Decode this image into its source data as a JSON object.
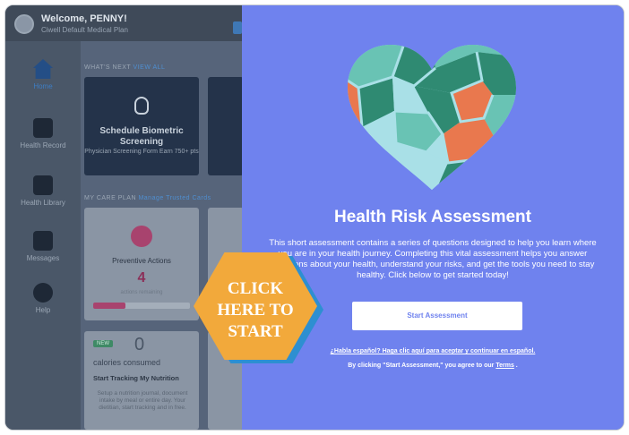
{
  "app": {
    "welcome": "Welcome, PENNY!",
    "plan_name": "Ciwell Default Medical Plan",
    "nav": [
      {
        "label": "Home",
        "icon": "home-icon"
      },
      {
        "label": "Health Record",
        "icon": "medical-record-icon"
      },
      {
        "label": "Health Library",
        "icon": "book-icon"
      },
      {
        "label": "Messages",
        "icon": "inbox-icon"
      },
      {
        "label": "Help",
        "icon": "info-icon"
      }
    ],
    "whats_next": {
      "label": "WHAT'S NEXT",
      "link": "VIEW ALL"
    },
    "biometric_card": {
      "title": "Schedule Biometric Screening",
      "subtitle": "Physician Screening Form Earn 750+ pts"
    },
    "care_plan": {
      "label": "MY CARE PLAN",
      "link": "Manage Trusted Cards"
    },
    "preventive_card": {
      "label": "Preventive Actions",
      "count": "4",
      "subtitle": "actions remaining",
      "progress": 0.33
    },
    "nutrition_card": {
      "badge": "NEW",
      "count": "0",
      "calories": "calories consumed",
      "title": "Start Tracking My Nutrition",
      "description": "Setup a nutrition journal, document intake by meal or entire day. Your dietitian, start tracking and in free."
    }
  },
  "panel": {
    "title": "Health Risk Assessment",
    "description": "This short assessment contains a series of questions designed to help you learn where you are in your health journey. Completing this vital assessment helps you answer questions about your health, understand your risks, and get the tools you need to stay healthy. Click below to get started today!",
    "start_button": "Start Assessment",
    "espanol_link": "¿Habla español? Haga clic aquí para aceptar y continuar en español.",
    "agree_prefix": "By clicking \"Start Assessment,\" you agree to our",
    "terms_link": "Terms",
    "agree_suffix": ".",
    "heart_icon": "heart-mosaic-icon"
  },
  "callout": {
    "lines": [
      "CLICK",
      "HERE TO",
      "START"
    ],
    "fill": "#f2a93b",
    "edge": "#2d8fd1"
  },
  "colors": {
    "panel_bg": "#6f82ee",
    "heart_green": "#2f8a72",
    "heart_teal": "#69c3b4",
    "heart_orange": "#e9784e",
    "heart_light": "#a9e0e7"
  }
}
